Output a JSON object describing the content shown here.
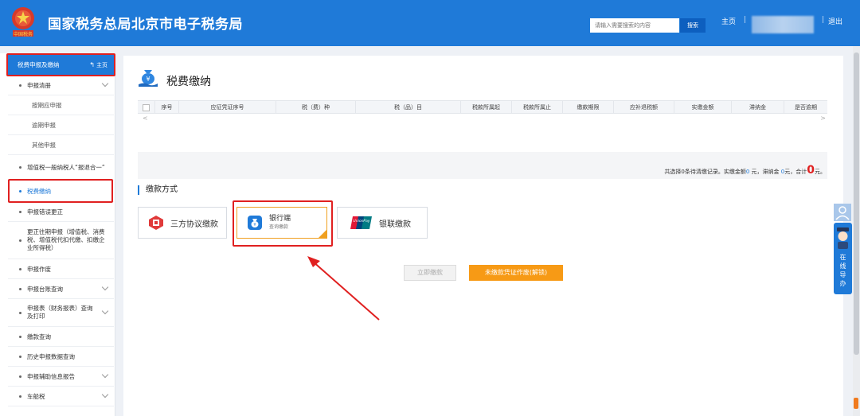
{
  "header": {
    "title": "国家税务总局北京市电子税务局",
    "emblem_text": "中国税务",
    "search_placeholder": "请输入需要搜索的内容",
    "search_button": "搜索",
    "home": "主页",
    "separator": "|",
    "logout": "退出"
  },
  "sidebar": {
    "head_label": "税费申报及缴纳",
    "head_home": "主页",
    "items": [
      {
        "label": "申报清册"
      },
      {
        "label": "按期应申报"
      },
      {
        "label": "逾期申报"
      },
      {
        "label": "其他申报"
      },
      {
        "label": "增值税一般纳税人“报退合一”"
      },
      {
        "label": "税费缴纳"
      },
      {
        "label": "申报错误更正"
      },
      {
        "label": "更正往期申报（增值税、消费税、增值税代扣代缴、扣缴企业所得税）"
      },
      {
        "label": "申报作废"
      },
      {
        "label": "申报台账查询"
      },
      {
        "label": "申报表（财务报表）查询及打印"
      },
      {
        "label": "缴款查询"
      },
      {
        "label": "历史申报数据查询"
      },
      {
        "label": "申报辅助信息报告"
      },
      {
        "label": "车船税"
      }
    ]
  },
  "main": {
    "title": "税费缴纳",
    "columns": [
      "序号",
      "应征凭证序号",
      "税（费）种",
      "税（品）目",
      "税款所属起",
      "税款所属止",
      "缴款期限",
      "应补退税额",
      "实缴金额",
      "滞纳金",
      "是否逾期"
    ],
    "scroll_left": "<",
    "scroll_right": ">",
    "summary": {
      "prefix": "共选择0条待清缴记录。实缴金额",
      "paid": "0",
      "mid1": " 元，滞纳金 ",
      "late": "0",
      "mid2": "元，合计",
      "total": "0",
      "suffix": "元。"
    },
    "section_title": "缴款方式",
    "methods": [
      {
        "label": "三方协议缴款"
      },
      {
        "label": "银行端",
        "sub": "查询缴款"
      },
      {
        "label": "银联缴款",
        "logo": "UnionPay"
      }
    ],
    "btn_pay_now": "立即缴款",
    "btn_void": "未缴款凭证作废(解锁)"
  },
  "floating": {
    "help_label": "在线导办"
  },
  "colors": {
    "brand": "#1f7ad8",
    "annotation": "#e02020",
    "accent_orange": "#f79a15"
  }
}
